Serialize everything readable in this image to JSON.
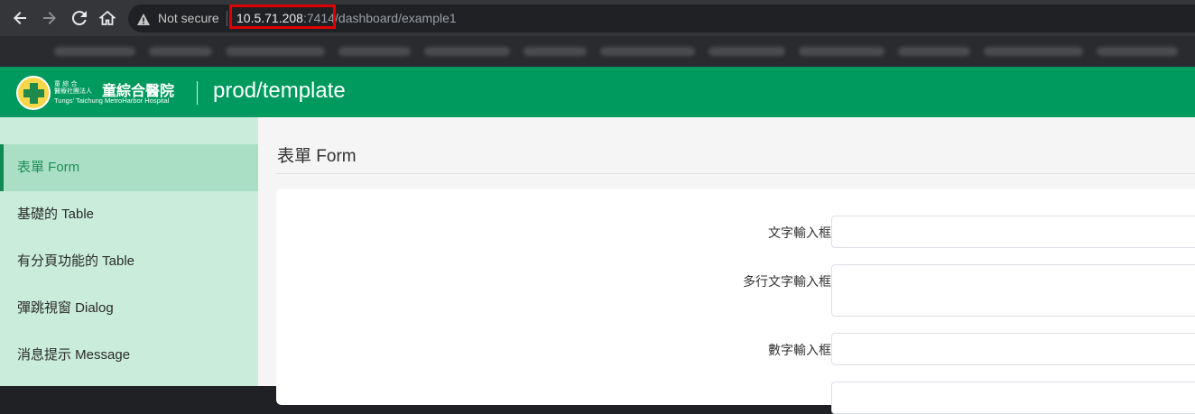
{
  "browser": {
    "security_label": "Not secure",
    "url_host": "10.5.71.208",
    "url_port": ":7414",
    "url_path": "/dashboard/example1"
  },
  "header": {
    "logo_small_line1": "童 綜 合",
    "logo_small_line2": "醫療社團法人",
    "logo_name": "童綜合醫院",
    "logo_english": "Tungs' Taichung MetroHarbor Hospital",
    "title": "prod/template",
    "brand_color": "#009a5e"
  },
  "sidebar": {
    "items": [
      {
        "label": "表單 Form",
        "active": true
      },
      {
        "label": "基礎的 Table",
        "active": false
      },
      {
        "label": "有分頁功能的 Table",
        "active": false
      },
      {
        "label": "彈跳視窗 Dialog",
        "active": false
      },
      {
        "label": "消息提示 Message",
        "active": false
      }
    ]
  },
  "main": {
    "page_title": "表單 Form",
    "form": {
      "text_label": "文字輸入框",
      "text_value": "",
      "textarea_label": "多行文字輸入框",
      "textarea_value": "",
      "number_label": "數字輸入框",
      "number_value": ""
    }
  }
}
